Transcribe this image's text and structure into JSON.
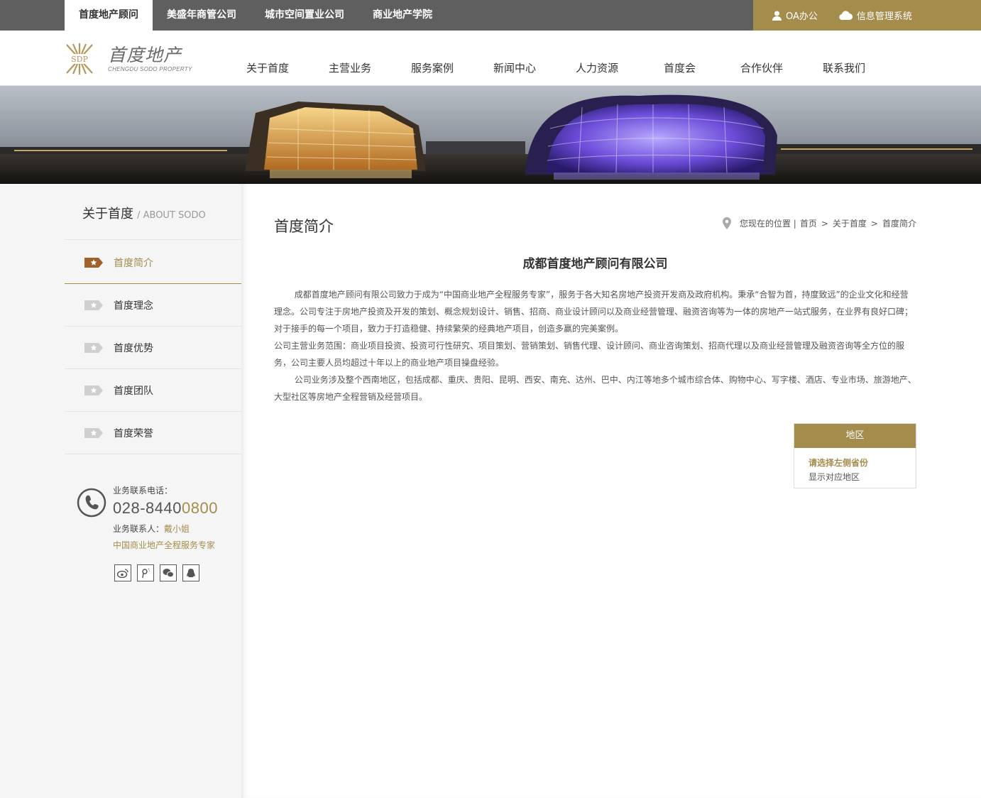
{
  "topbar": {
    "tabs": [
      {
        "label": "首度地产顾问",
        "active": true
      },
      {
        "label": "美盛年商管公司",
        "active": false
      },
      {
        "label": "城市空间置业公司",
        "active": false
      },
      {
        "label": "商业地产学院",
        "active": false
      }
    ],
    "oa_label": "OA办公",
    "info_label": "信息管理系统"
  },
  "logo": {
    "badge": "SDP",
    "cn": "首度地产",
    "en": "CHENGDU SODO PROPERTY"
  },
  "nav": {
    "items": [
      "关于首度",
      "主营业务",
      "服务案例",
      "新闻中心",
      "人力资源",
      "首度会",
      "合作伙伴",
      "联系我们"
    ]
  },
  "sidebar": {
    "title_cn": "关于首度",
    "title_en": "/ ABOUT SODO",
    "menu": [
      {
        "label": "首度简介",
        "active": true
      },
      {
        "label": "首度理念",
        "active": false
      },
      {
        "label": "首度优势",
        "active": false
      },
      {
        "label": "首度团队",
        "active": false
      },
      {
        "label": "首度荣誉",
        "active": false
      }
    ],
    "contact": {
      "phone_label": "业务联系电话：",
      "phone_main": "028-8440",
      "phone_highlight": "0800",
      "person_label": "业务联系人：",
      "person_name": "戴小姐",
      "slogan": "中国商业地产全程服务专家"
    },
    "socials": [
      "weibo-icon",
      "tencent-weibo-icon",
      "wechat-icon",
      "qq-icon"
    ]
  },
  "main": {
    "page_title": "首度简介",
    "breadcrumb": {
      "prefix": "您现在的位置 |",
      "items": [
        "首页",
        "关于首度",
        "首度简介"
      ],
      "separator": ">"
    },
    "article_title": "成都首度地产顾问有限公司",
    "paragraphs": [
      {
        "text": "成都首度地产顾问有限公司致力于成为“中国商业地产全程服务专家”，服务于各大知名房地产投资开发商及政府机构。秉承“合智为首，持度致远”的企业文化和经营理念。公司专注于房地产投资及开发的策划、概念规划设计、销售、招商、商业设计顾问以及商业经营管理、融资咨询等为一体的房地产一站式服务，在业界有良好口碑；对于接手的每一个项目，致力于打造稳健、持续繁荣的经典地产项目，创造多赢的完美案例。",
        "indent": true
      },
      {
        "text": "公司主营业务范围：商业项目投资、投资可行性研究、项目策划、营销策划、销售代理、设计顾问、商业咨询策划、招商代理以及商业经营管理及融资咨询等全方位的服务，公司主要人员均超过十年以上的商业地产项目操盘经验。",
        "indent": false
      },
      {
        "text": "公司业务涉及整个西南地区，包括成都、重庆、贵阳、昆明、西安、南充、达州、巴中、内江等地多个城市综合体、购物中心、写字楼、酒店、专业市场、旅游地产、大型社区等房地产全程营销及经营项目。",
        "indent": true
      }
    ],
    "region": {
      "header": "地区",
      "line1": "请选择左侧省份",
      "line2": "显示对应地区"
    }
  },
  "colors": {
    "accent": "#a48c4c",
    "topbar": "#5f5f5f"
  }
}
